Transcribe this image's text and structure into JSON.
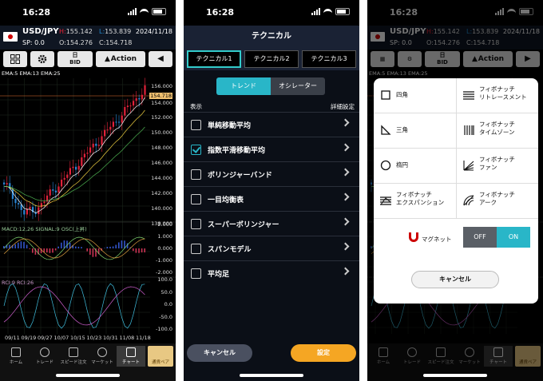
{
  "status": {
    "time": "16:28"
  },
  "panel1": {
    "pair": "USD/JPY",
    "spread": "SP: 0.0",
    "high_label": "H:",
    "high": "155.142",
    "open_label": "O:",
    "open": "154.276",
    "low_label": "L:",
    "low": "153.839",
    "close_label": "C:",
    "close": "154.718",
    "date": "2024/11/18",
    "toolbar": {
      "bid_top": "日",
      "bid": "BID",
      "action": "Action"
    },
    "ema_label": "EMA:5 EMA:13 EMA:25",
    "price_ticks": [
      "156.000",
      "154.718",
      "154.000",
      "152.000",
      "150.000",
      "148.000",
      "146.000",
      "144.000",
      "142.000",
      "140.000",
      "138.000"
    ],
    "macd_label": "MACD:12,26  SIGNAL:9  OSC(上昇)",
    "macd_ticks": [
      "2.000",
      "1.000",
      "0.000",
      "-1.000",
      "-2.000"
    ],
    "rci_label": "RCI:9  RCI:26",
    "rci_ticks": [
      "100.0",
      "50.0",
      "0.0",
      "-50.0",
      "-100.0"
    ],
    "x_ticks": [
      "09/11",
      "09/19",
      "09/27",
      "10/07",
      "10/15",
      "10/23",
      "10/31",
      "11/08",
      "11/18"
    ],
    "tabs": [
      "ホーム",
      "トレード",
      "スピード注文",
      "マーケット",
      "チャート"
    ],
    "swap": "通貨ペア"
  },
  "panel2": {
    "title": "テクニカル",
    "tabs": [
      "テクニカル1",
      "テクニカル2",
      "テクニカル3"
    ],
    "segments": [
      "トレンド",
      "オシレーター"
    ],
    "col_display": "表示",
    "col_detail": "詳細設定",
    "rows": [
      "単純移動平均",
      "指数平滑移動平均",
      "ボリンジャーバンド",
      "一目均衡表",
      "スーパーボリンジャー",
      "スパンモデル",
      "平均足"
    ],
    "checked_index": 1,
    "cancel": "キャンセル",
    "ok": "設定"
  },
  "panel3": {
    "tools": [
      {
        "icon": "rectangle-icon",
        "label": "四角"
      },
      {
        "icon": "fib-retracement-icon",
        "label": "フィボナッチ\nリトレースメント"
      },
      {
        "icon": "triangle-icon",
        "label": "三角"
      },
      {
        "icon": "fib-timezone-icon",
        "label": "フィボナッチ\nタイムゾーン"
      },
      {
        "icon": "ellipse-icon",
        "label": "楕円"
      },
      {
        "icon": "fib-fan-icon",
        "label": "フィボナッチ\nファン"
      },
      {
        "icon": "fib-expansion-icon",
        "label": "フィボナッチ\nエクスパンション"
      },
      {
        "icon": "fib-arc-icon",
        "label": "フィボナッチ\nアーク"
      }
    ],
    "magnet_label": "マグネット",
    "off": "OFF",
    "on": "ON",
    "cancel": "キャンセル"
  },
  "colors": {
    "accent": "#29b6c8",
    "ok": "#f5a623",
    "up": "#e2213a",
    "down": "#2a86d6"
  }
}
